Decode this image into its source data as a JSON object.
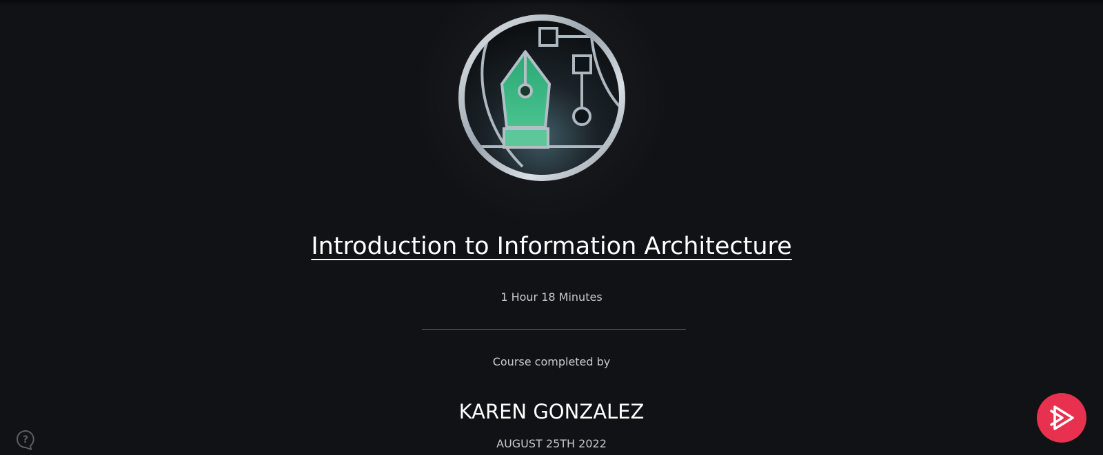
{
  "course": {
    "title": "Introduction to Information Architecture",
    "duration": "1 Hour 18 Minutes",
    "badge_icon": "pen-nib-diagram-badge-icon"
  },
  "certificate": {
    "completed_by_label": "Course completed by",
    "learner_name": "KAREN GONZALEZ",
    "completion_date": "AUGUST 25TH 2022"
  },
  "widgets": {
    "help_icon": "help-question-icon",
    "brand_icon": "pluralsight-play-icon"
  },
  "colors": {
    "background": "#111215",
    "badge_green": "#2fb57c",
    "badge_silver": "#c6ced6",
    "brand_red": "#e8314f",
    "text_secondary": "#c9cacd"
  }
}
